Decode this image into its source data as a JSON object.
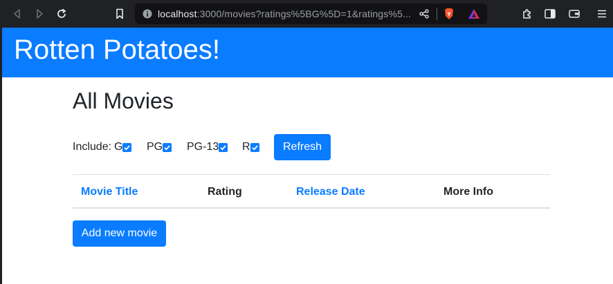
{
  "browser": {
    "url_host": "localhost",
    "url_rest": ":3000/movies?ratings%5BG%5D=1&ratings%5..."
  },
  "navbar": {
    "brand": "Rotten Potatoes!"
  },
  "page": {
    "title": "All Movies"
  },
  "filters": {
    "include_label": "Include:",
    "ratings": [
      {
        "label": "G",
        "checked": true
      },
      {
        "label": "PG",
        "checked": true
      },
      {
        "label": "PG-13",
        "checked": true
      },
      {
        "label": "R",
        "checked": true
      }
    ],
    "refresh_label": "Refresh"
  },
  "table": {
    "columns": [
      {
        "label": "Movie Title",
        "sortable": true
      },
      {
        "label": "Rating",
        "sortable": false
      },
      {
        "label": "Release Date",
        "sortable": true
      },
      {
        "label": "More Info",
        "sortable": false
      }
    ],
    "rows": []
  },
  "actions": {
    "add_movie_label": "Add new movie"
  },
  "colors": {
    "primary": "#0a7cff",
    "chrome": "#202124",
    "text": "#212529"
  }
}
